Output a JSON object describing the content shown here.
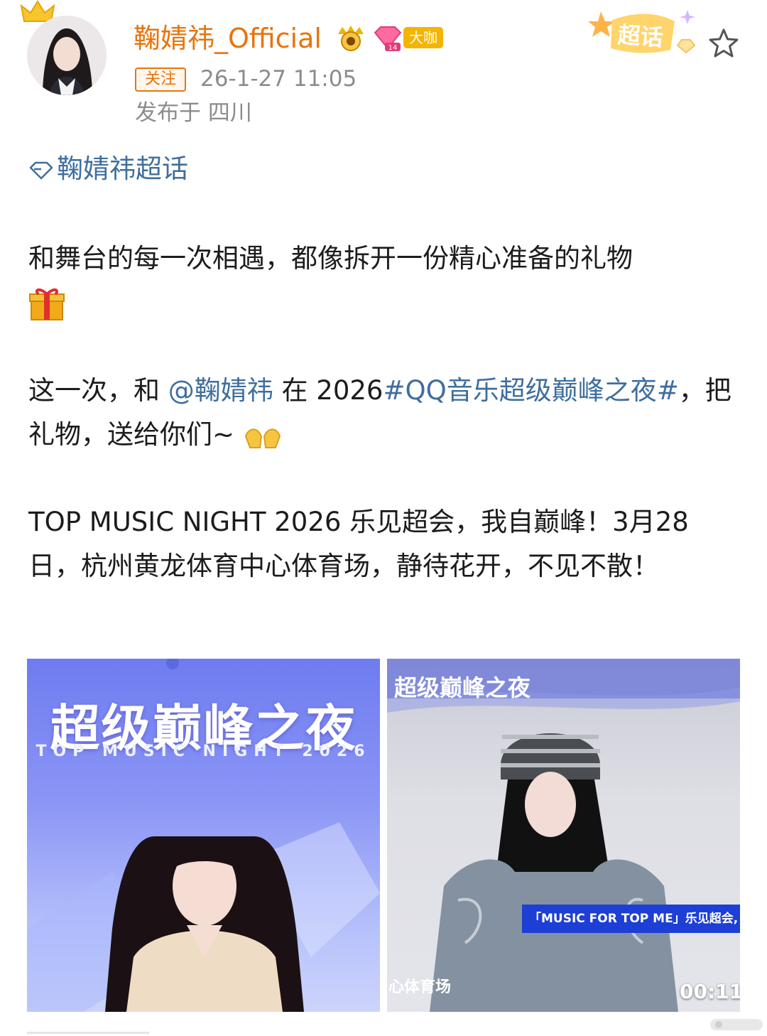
{
  "user": {
    "name": "鞠婧祎_Official",
    "badge_label": "大咖",
    "follow_label": "关注",
    "time": "26-1-27 11:05",
    "location": "发布于 四川",
    "chaohua_label": "超话"
  },
  "post": {
    "topic": "鞠婧祎超话",
    "p1_text": "和舞台的每一次相遇，都像拆开一份精心准备的礼物",
    "p2_prefix": "这一次，和 ",
    "p2_mention": "@鞠婧祎",
    "p2_mid": " 在 2026",
    "p2_hashtag": "#QQ音乐超级巅峰之夜#",
    "p2_suffix": "，把礼物，送给你们~",
    "p3_text": "TOP MUSIC NIGHT 2026 乐见超会，我自巅峰！3月28日，杭州黄龙体育中心体育场，静待花开，不见不散！"
  },
  "media": [
    {
      "title": "超级巅峰之夜",
      "subtitle": "TOP MUSIC NIGHT 2026"
    },
    {
      "title": "超级巅峰之夜",
      "caption": "「MUSIC FOR TOP ME」乐见超会,",
      "bottom_text": "心体育场",
      "duration": "00:11"
    }
  ],
  "colors": {
    "username": "#e8740c",
    "link": "#3f6e9e",
    "badge": "#f4b400",
    "meta_text": "#8c8c8c"
  },
  "icons": [
    "crown-icon",
    "vip-icon",
    "level-icon",
    "chaohua-icon",
    "star-icon",
    "diamond-icon",
    "gift-emoji-icon",
    "hands-emoji-icon"
  ]
}
